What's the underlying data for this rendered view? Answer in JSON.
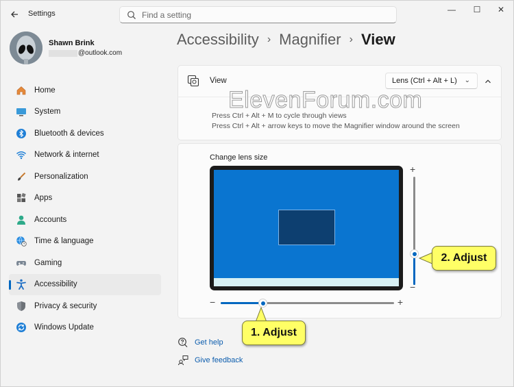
{
  "window": {
    "app_title": "Settings",
    "search_placeholder": "Find a setting",
    "controls": {
      "minimize": "—",
      "maximize": "☐",
      "close": "✕"
    }
  },
  "profile": {
    "name": "Shawn Brink",
    "email_suffix": "@outlook.com"
  },
  "sidebar": {
    "items": [
      {
        "label": "Home",
        "icon": "home-icon"
      },
      {
        "label": "System",
        "icon": "system-icon"
      },
      {
        "label": "Bluetooth & devices",
        "icon": "bluetooth-icon"
      },
      {
        "label": "Network & internet",
        "icon": "wifi-icon"
      },
      {
        "label": "Personalization",
        "icon": "brush-icon"
      },
      {
        "label": "Apps",
        "icon": "apps-icon"
      },
      {
        "label": "Accounts",
        "icon": "accounts-icon"
      },
      {
        "label": "Time & language",
        "icon": "globe-clock-icon"
      },
      {
        "label": "Gaming",
        "icon": "gamepad-icon"
      },
      {
        "label": "Accessibility",
        "icon": "accessibility-icon",
        "selected": true
      },
      {
        "label": "Privacy & security",
        "icon": "shield-icon"
      },
      {
        "label": "Windows Update",
        "icon": "update-icon"
      }
    ]
  },
  "breadcrumb": {
    "parts": [
      "Accessibility",
      "Magnifier"
    ],
    "current": "View",
    "separator": "›"
  },
  "view_card": {
    "label": "View",
    "dropdown_value": "Lens (Ctrl + Alt + L)",
    "hint_1": "Press Ctrl + Alt + M to cycle through views",
    "hint_2": "Press Ctrl + Alt + arrow keys to move the Magnifier window around the screen"
  },
  "lens_card": {
    "title": "Change lens size",
    "width_slider_level": 0.24,
    "height_slider_level": 0.29
  },
  "links": {
    "help": "Get help",
    "feedback": "Give feedback"
  },
  "annotations": {
    "callout_1": "1. Adjust",
    "callout_2": "2. Adjust",
    "watermark": "ElevenForum.com"
  },
  "colors": {
    "accent": "#0067c0",
    "callout": "#ffff66",
    "screen_blue": "#0a75d0"
  }
}
